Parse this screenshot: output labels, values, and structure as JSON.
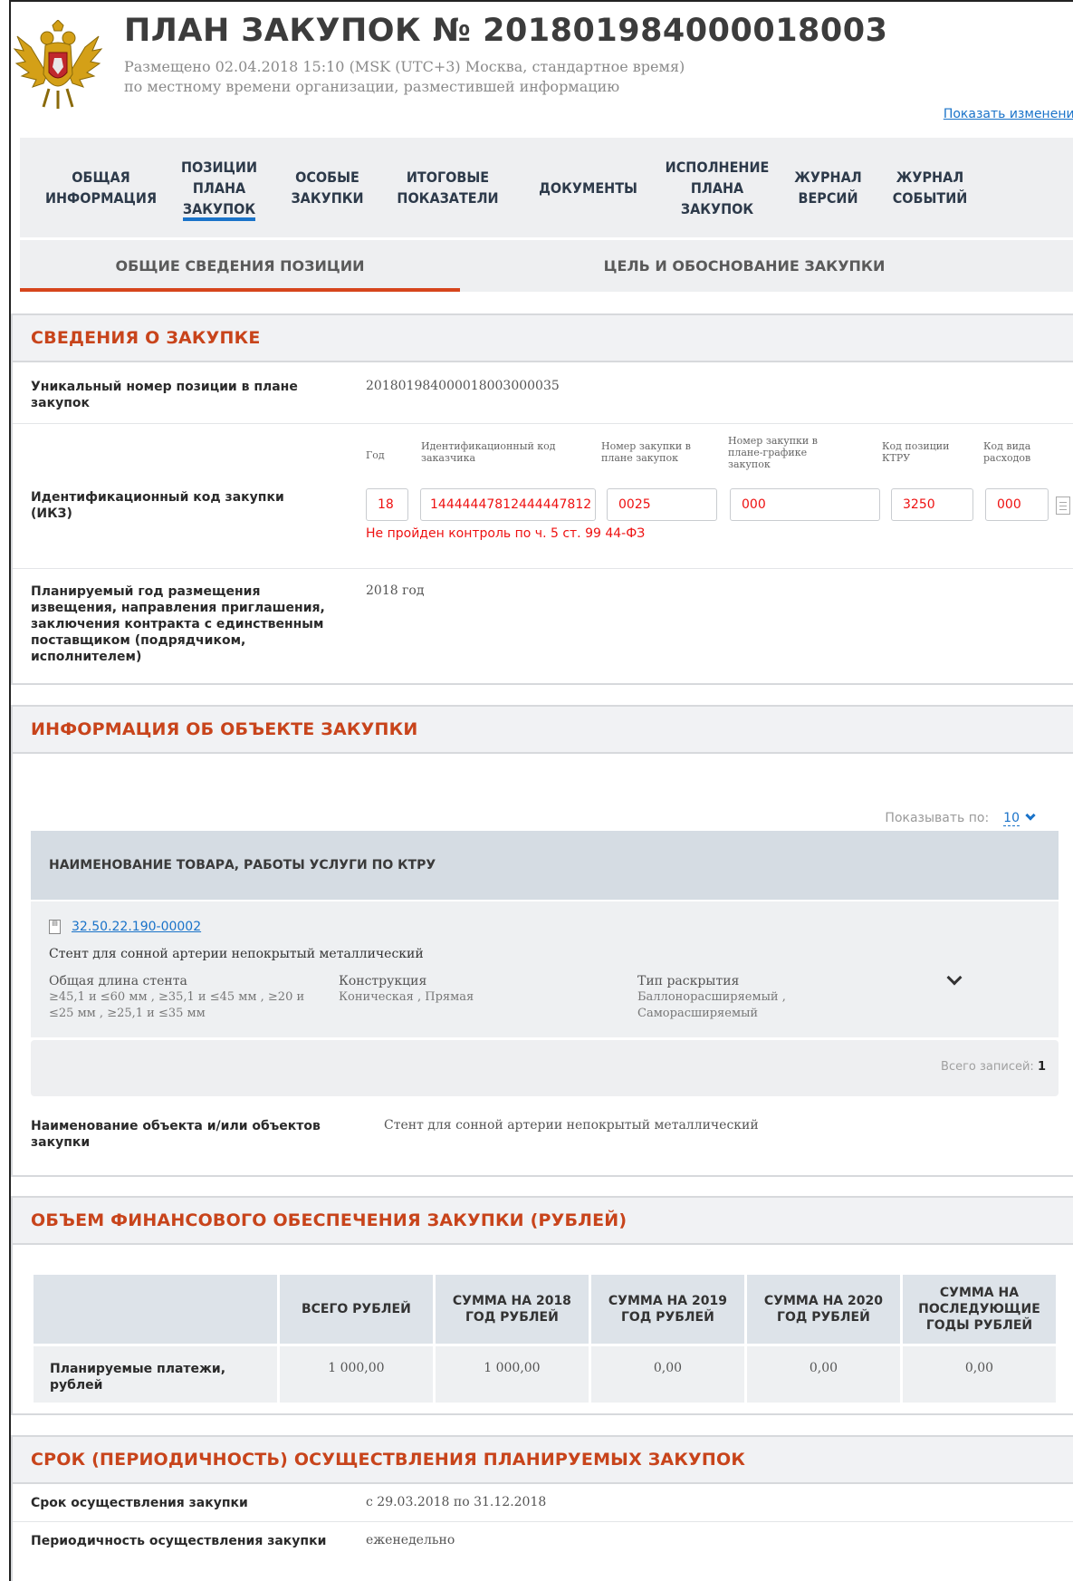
{
  "header": {
    "title": "ПЛАН ЗАКУПОК № 201801984000018003",
    "posted": "Размещено 02.04.2018 15:10 (MSK (UTC+3) Москва, стандартное время)",
    "posted_note": "по местному времени организации, разместившей информацию",
    "show_changes": "Показать изменения"
  },
  "tabs": [
    {
      "label": "ОБЩАЯ\nИНФОРМАЦИЯ"
    },
    {
      "label": "ПОЗИЦИИ\nПЛАНА\nЗАКУПОК",
      "active": true
    },
    {
      "label": "ОСОБЫЕ\nЗАКУПКИ"
    },
    {
      "label": "ИТОГОВЫЕ\nПОКАЗАТЕЛИ"
    },
    {
      "label": "ДОКУМЕНТЫ"
    },
    {
      "label": "ИСПОЛНЕНИЕ\nПЛАНА\nЗАКУПОК"
    },
    {
      "label": "ЖУРНАЛ\nВЕРСИЙ"
    },
    {
      "label": "ЖУРНАЛ\nСОБЫТИЙ"
    }
  ],
  "subtabs": [
    {
      "label": "ОБЩИЕ СВЕДЕНИЯ ПОЗИЦИИ",
      "active": true
    },
    {
      "label": "ЦЕЛЬ И ОБОСНОВАНИЕ ЗАКУПКИ"
    }
  ],
  "purchase_info": {
    "heading": "СВЕДЕНИЯ О ЗАКУПКЕ",
    "position_label": "Уникальный номер позиции в плане закупок",
    "position_value": "201801984000018003000035",
    "ikz_label": "Идентификационный код закупки (ИКЗ)",
    "ikz_captions": {
      "year": "Год",
      "customer": "Идентификационный код заказчика",
      "plan_no": "Номер закупки в плане закупок",
      "schedule_no": "Номер закупки в плане-графике закупок",
      "ktru": "Код позиции КТРУ",
      "expense": "Код вида расходов"
    },
    "ikz_values": {
      "year": "18",
      "customer": "14444447812444447812",
      "plan_no": "0025",
      "schedule_no": "000",
      "ktru": "3250",
      "expense": "000"
    },
    "ikz_error": "Не пройден контроль по ч. 5 ст. 99 44-ФЗ",
    "planned_year_label": "Планируемый год размещения извещения, направления приглашения, заключения контракта с единственным поставщиком (подрядчиком, исполнителем)",
    "planned_year_value": "2018 год"
  },
  "object_info": {
    "heading": "ИНФОРМАЦИЯ ОБ ОБЪЕКТЕ ЗАКУПКИ",
    "page_size_label": "Показывать по:",
    "page_size_value": "10",
    "table_header": "НАИМЕНОВАНИЕ ТОВАРА, РАБОТЫ УСЛУГИ ПО КТРУ",
    "item": {
      "code": "32.50.22.190-00002",
      "name": "Стент для сонной артерии непокрытый металлический",
      "chars": [
        {
          "name": "Общая длина стента",
          "value": "≥45,1 и ≤60 мм , ≥35,1 и ≤45 мм , ≥20 и ≤25 мм , ≥25,1 и ≤35 мм"
        },
        {
          "name": "Конструкция",
          "value": "Коническая , Прямая"
        },
        {
          "name": "Тип раскрытия",
          "value": "Баллонорасширяемый , Саморасширяемый"
        }
      ]
    },
    "total_label": "Всего записей:",
    "total_value": "1",
    "object_name_label": "Наименование объекта и/или объектов закупки",
    "object_name_value": "Стент для сонной артерии непокрытый металлический"
  },
  "finance": {
    "heading": "ОБЪЕМ ФИНАНСОВОГО ОБЕСПЕЧЕНИЯ ЗАКУПКИ (РУБЛЕЙ)",
    "columns": [
      "ВСЕГО РУБЛЕЙ",
      "СУММА НА 2018 ГОД РУБЛЕЙ",
      "СУММА НА 2019 ГОД РУБЛЕЙ",
      "СУММА НА 2020 ГОД РУБЛЕЙ",
      "СУММА НА ПОСЛЕДУЮЩИЕ ГОДЫ РУБЛЕЙ"
    ],
    "row_label": "Планируемые платежи, рублей",
    "values": [
      "1 000,00",
      "1 000,00",
      "0,00",
      "0,00",
      "0,00"
    ]
  },
  "term": {
    "heading": "СРОК (ПЕРИОДИЧНОСТЬ) ОСУЩЕСТВЛЕНИЯ ПЛАНИРУЕМЫХ ЗАКУПОК",
    "term_label": "Срок осуществления закупки",
    "term_value": "с 29.03.2018 по 31.12.2018",
    "period_label": "Периодичность осуществления закупки",
    "period_value": "еженедельно"
  },
  "colors": {
    "accent": "#c8441b",
    "link": "#1a73c9",
    "error": "#e11111",
    "tab_bg": "#eeeff1"
  },
  "icons": [
    "coat-of-arms",
    "document-icon",
    "ktru-icon",
    "chevron-down-icon"
  ]
}
